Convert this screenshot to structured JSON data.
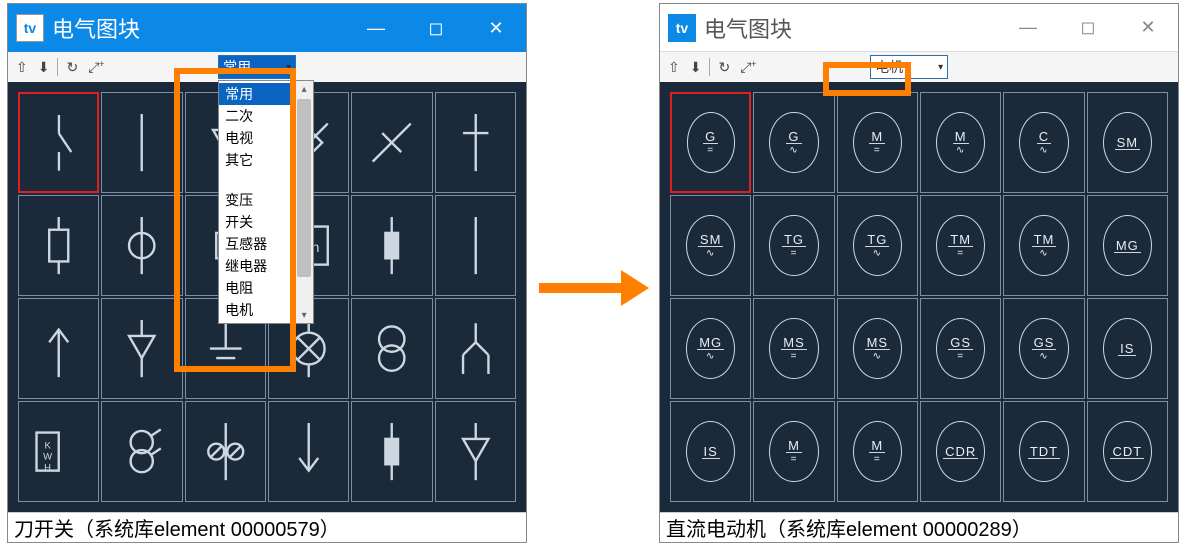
{
  "left_window": {
    "title": "电气图块",
    "toolbar": {
      "dropdown_selected": "常用",
      "dropdown_options": [
        "常用",
        "二次",
        "电视",
        "其它",
        "",
        "变压",
        "开关",
        "互感器",
        "继电器",
        "电阻",
        "电机"
      ]
    },
    "status": "刀开关（系统库element 00000579）",
    "grid_symbols": [
      "switch-open",
      "line",
      "triangle",
      "fuse-diag",
      "fuse-slash",
      "diode",
      "fuse-box",
      "circle-line",
      "square-vert",
      "wh-meter",
      "fuse-vert",
      "line",
      "arrow-up",
      "triangle-down",
      "ground",
      "lamp-x",
      "two-circles",
      "fork",
      "kwh-meter",
      "two-circles-slash",
      "slash-lines",
      "arrow-down",
      "fuse-vert",
      "triangle-down"
    ]
  },
  "right_window": {
    "title": "电气图块",
    "toolbar": {
      "dropdown_selected": "电机"
    },
    "status": "直流电动机（系统库element 00000289）",
    "grid_motors": [
      {
        "t": "G",
        "s": "="
      },
      {
        "t": "G",
        "s": "~"
      },
      {
        "t": "M",
        "s": "="
      },
      {
        "t": "M",
        "s": "~"
      },
      {
        "t": "C",
        "s": "~"
      },
      {
        "t": "SM",
        "s": ""
      },
      {
        "t": "SM",
        "s": "~"
      },
      {
        "t": "TG",
        "s": "="
      },
      {
        "t": "TG",
        "s": "~"
      },
      {
        "t": "TM",
        "s": "="
      },
      {
        "t": "TM",
        "s": "~"
      },
      {
        "t": "MG",
        "s": ""
      },
      {
        "t": "MG",
        "s": "~"
      },
      {
        "t": "MS",
        "s": "="
      },
      {
        "t": "MS",
        "s": "~"
      },
      {
        "t": "GS",
        "s": "="
      },
      {
        "t": "GS",
        "s": "~"
      },
      {
        "t": "IS",
        "s": ""
      },
      {
        "t": "IS",
        "s": ""
      },
      {
        "t": "M",
        "s": "="
      },
      {
        "t": "M",
        "s": "="
      },
      {
        "t": "CDR",
        "s": ""
      },
      {
        "t": "TDT",
        "s": ""
      },
      {
        "t": "CDT",
        "s": ""
      }
    ]
  }
}
